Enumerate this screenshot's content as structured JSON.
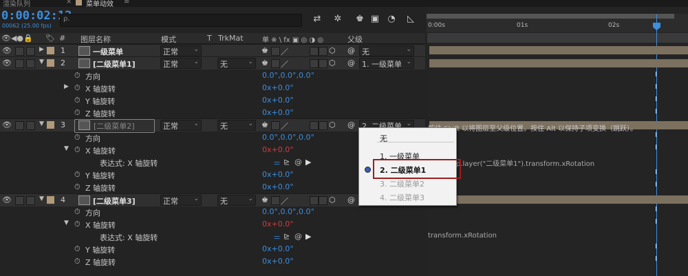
{
  "tabs": {
    "render_queue": "渲染队列",
    "close": "×",
    "comp": "菜单动效",
    "menu": "≡"
  },
  "header": {
    "timecode": "0:00:02:12",
    "fps": "00062 (25.00 fps)",
    "search_placeholder": "ρ."
  },
  "columns": {
    "layer_name": "图层名称",
    "mode": "模式",
    "t": "T",
    "trkmat": "TrkMat",
    "switches": "单 ※ \\ fx ▣ ◎ ◑ ◎",
    "parent": "父级",
    "num": "#"
  },
  "ruler": {
    "t0": "0:00s",
    "t1": "01s",
    "t2": "02s"
  },
  "layers": [
    {
      "num": "1",
      "name": "一级菜单",
      "mode": "正常",
      "trkmat": "",
      "parent": "无"
    },
    {
      "num": "2",
      "name": "[二级菜单1]",
      "mode": "正常",
      "trkmat": "无",
      "parent": "1. 一级菜单",
      "props": [
        {
          "label": "方向",
          "value": "0.0°,0.0°,0.0°"
        },
        {
          "label": "X 轴旋转",
          "value": "0x+0.0°"
        },
        {
          "label": "Y 轴旋转",
          "value": "0x+0.0°"
        },
        {
          "label": "Z 轴旋转",
          "value": "0x+0.0°"
        }
      ]
    },
    {
      "num": "3",
      "name": "[二级菜单2]",
      "mode": "正常",
      "trkmat": "无",
      "parent": "2. 二级菜单",
      "props": [
        {
          "label": "方向",
          "value": "0.0°,0.0°,0.0°"
        },
        {
          "label": "X 轴旋转",
          "value": "0x+0.0°"
        },
        {
          "label": "表达式: X 轴旋转",
          "value": ""
        },
        {
          "label": "Y 轴旋转",
          "value": "0x+0.0°"
        },
        {
          "label": "Z 轴旋转",
          "value": "0x+0.0°"
        }
      ]
    },
    {
      "num": "4",
      "name": "[二级菜单3]",
      "mode": "正常",
      "trkmat": "无",
      "parent": "",
      "props": [
        {
          "label": "方向",
          "value": "0.0°,0.0°,0.0°"
        },
        {
          "label": "X 轴旋转",
          "value": "0x+0.0°"
        },
        {
          "label": "表达式: X 轴旋转",
          "value": ""
        },
        {
          "label": "Y 轴旋转",
          "value": "0x+0.0°"
        },
        {
          "label": "Z 轴旋转",
          "value": "0x+0.0°"
        }
      ]
    }
  ],
  "hint": "按住 Shift 以将图层至父级位置。按住 Alt 以保持子项变换（跳跃）。",
  "expr1": "p.layer(\"二级菜单1\").transform.xRotation",
  "expr2": "transform.xRotation",
  "popup": {
    "items": [
      "无",
      "1. 一级菜单",
      "2. 二级菜单1",
      "3. 二级菜单2",
      "4. 二级菜单3"
    ],
    "selected": "2. 二级菜单1"
  },
  "colors": {
    "timecode": "#3d8fe0",
    "label": "#b19a7a",
    "highlight": "#9c1d1d",
    "bar": "#7c705f"
  }
}
